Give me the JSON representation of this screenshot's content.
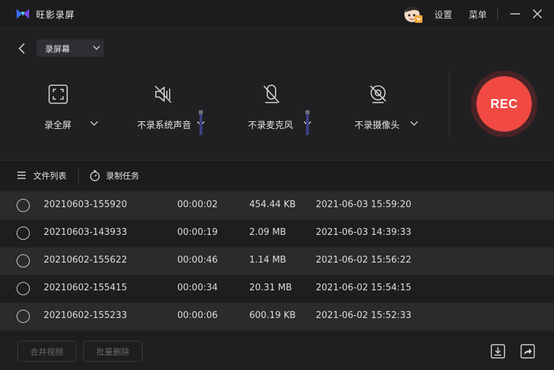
{
  "titlebar": {
    "app_name": "旺影录屏",
    "settings_label": "设置",
    "menu_label": "菜单"
  },
  "controls": {
    "mode": "录屏幕",
    "screen_label": "录全屏",
    "system_audio_label": "不录系统声音",
    "mic_label": "不录麦克风",
    "camera_label": "不录摄像头",
    "rec_label": "REC"
  },
  "tabs": {
    "files_label": "文件列表",
    "tasks_label": "录制任务"
  },
  "files": [
    {
      "name": "20210603-155920",
      "duration": "00:00:02",
      "size": "454.44 KB",
      "date": "2021-06-03 15:59:20"
    },
    {
      "name": "20210603-143933",
      "duration": "00:00:19",
      "size": "2.09 MB",
      "date": "2021-06-03 14:39:33"
    },
    {
      "name": "20210602-155622",
      "duration": "00:00:46",
      "size": "1.14 MB",
      "date": "2021-06-02 15:56:22"
    },
    {
      "name": "20210602-155415",
      "duration": "00:00:34",
      "size": "20.31 MB",
      "date": "2021-06-02 15:54:15"
    },
    {
      "name": "20210602-155233",
      "duration": "00:00:06",
      "size": "600.19 KB",
      "date": "2021-06-02 15:52:33"
    }
  ],
  "footer": {
    "merge_label": "合并视频",
    "batch_delete_label": "批量删除"
  },
  "colors": {
    "accent_rec": "#f04a43",
    "volume_track": "#3e3f84",
    "background": "#1e1e20"
  }
}
